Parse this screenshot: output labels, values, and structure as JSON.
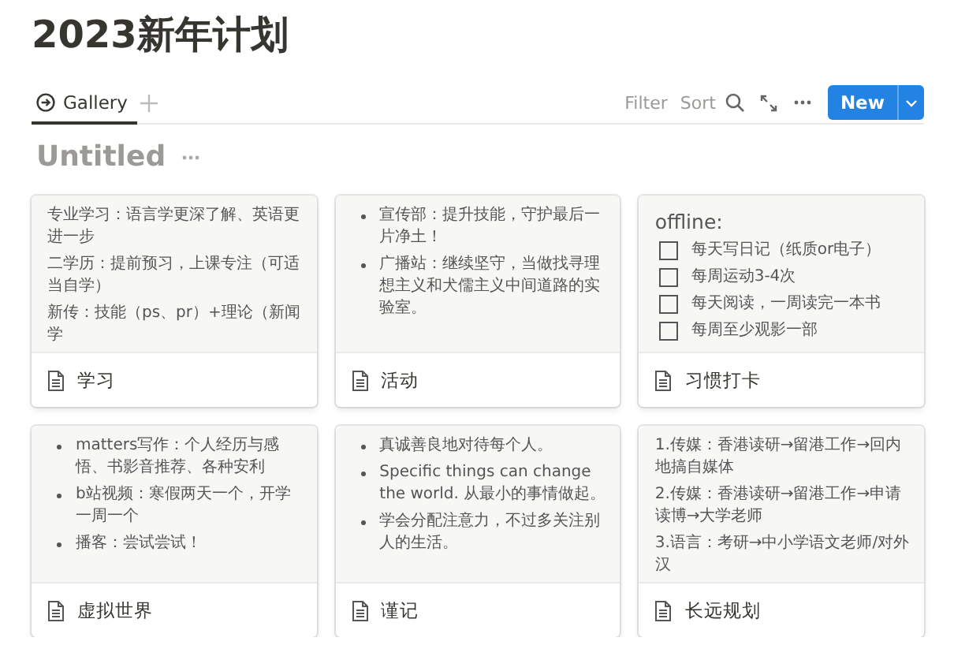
{
  "page_title": "2023新年计划",
  "views": [
    {
      "label": "Gallery",
      "selected": true
    }
  ],
  "toolbar": {
    "actions": [
      "Filter",
      "Sort"
    ],
    "new_button": "New"
  },
  "group_title": "Untitled",
  "cards": [
    {
      "title": "学习",
      "blocks": [
        {
          "kind": "paragraph",
          "text": "专业学习：语言学更深了解、英语更进一步"
        },
        {
          "kind": "paragraph",
          "text": "二学历：提前预习，上课专注（可适当自学）"
        },
        {
          "kind": "paragraph",
          "text": "新传：技能（ps、pr）+理论（新闻学"
        }
      ]
    },
    {
      "title": "活动",
      "blocks": [
        {
          "kind": "bullet",
          "text": "宣传部：提升技能，守护最后一片净土！"
        },
        {
          "kind": "bullet",
          "text": "广播站：继续坚守，当做找寻理想主义和犬儒主义中间道路的实验室。"
        }
      ]
    },
    {
      "title": "习惯打卡",
      "blocks": [
        {
          "kind": "heading",
          "text": "offline:"
        },
        {
          "kind": "todo",
          "text": "每天写日记（纸质or电子）",
          "checked": false
        },
        {
          "kind": "todo",
          "text": "每周运动3-4次",
          "checked": false
        },
        {
          "kind": "todo",
          "text": "每天阅读，一周读完一本书",
          "checked": false
        },
        {
          "kind": "todo",
          "text": "每周至少观影一部",
          "checked": false
        }
      ]
    },
    {
      "title": "虚拟世界",
      "blocks": [
        {
          "kind": "bullet",
          "text": "matters写作：个人经历与感悟、书影音推荐、各种安利"
        },
        {
          "kind": "bullet",
          "text": "b站视频：寒假两天一个，开学一周一个"
        },
        {
          "kind": "bullet",
          "text": "播客：尝试尝试！"
        }
      ]
    },
    {
      "title": "谨记",
      "blocks": [
        {
          "kind": "bullet",
          "text": "真诚善良地对待每个人。"
        },
        {
          "kind": "bullet",
          "text": "Specific things can change the world. 从最小的事情做起。"
        },
        {
          "kind": "bullet",
          "text": "学会分配注意力，不过多关注别人的生活。"
        }
      ]
    },
    {
      "title": "长远规划",
      "blocks": [
        {
          "kind": "paragraph",
          "text": "1.传媒：香港读研→留港工作→回内地搞自媒体"
        },
        {
          "kind": "paragraph",
          "text": "2.传媒：香港读研→留港工作→申请读博→大学老师"
        },
        {
          "kind": "paragraph",
          "text": "3.语言：考研→中小学语文老师/对外汉"
        }
      ]
    }
  ]
}
